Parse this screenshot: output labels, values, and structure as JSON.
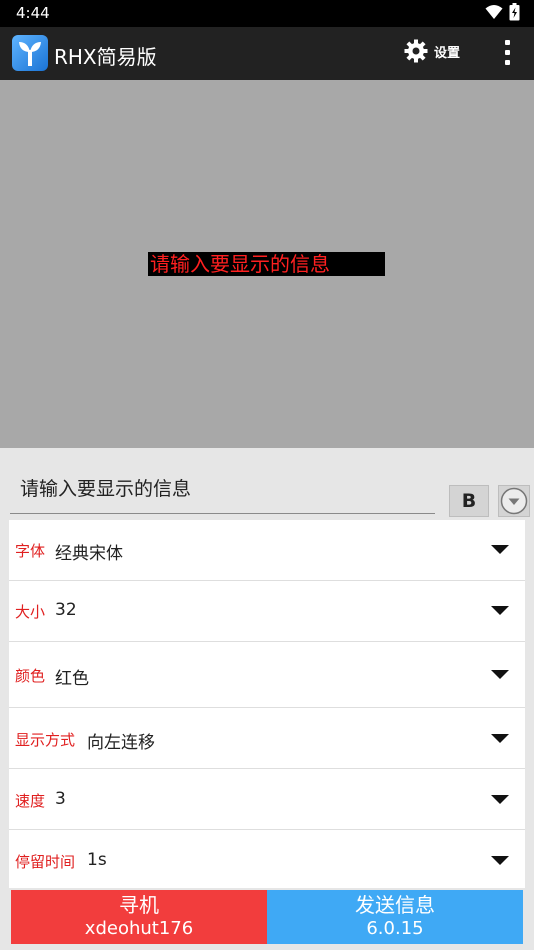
{
  "status_bar": {
    "time": "4:44"
  },
  "app_bar": {
    "title": "RHX简易版",
    "settings_label": "设置"
  },
  "preview": {
    "text": "请输入要显示的信息"
  },
  "input": {
    "value": "请输入要显示的信息",
    "bold_label": "B"
  },
  "options": [
    {
      "label": "字体",
      "value": "经典宋体"
    },
    {
      "label": "大小",
      "value": "32"
    },
    {
      "label": "颜色",
      "value": "红色"
    },
    {
      "label": "显示方式",
      "value": "向左连移"
    },
    {
      "label": "速度",
      "value": "3"
    },
    {
      "label": "停留时间",
      "value": "1s"
    }
  ],
  "buttons": {
    "find": {
      "label": "寻机",
      "sub": "xdeohut176"
    },
    "send": {
      "label": "发送信息",
      "sub": "6.0.15"
    }
  },
  "colors": {
    "preview_text": "#ff2020",
    "option_label": "#e02020",
    "find_button": "#f23d3d",
    "send_button": "#3fa9f5",
    "app_bar": "#222222"
  }
}
